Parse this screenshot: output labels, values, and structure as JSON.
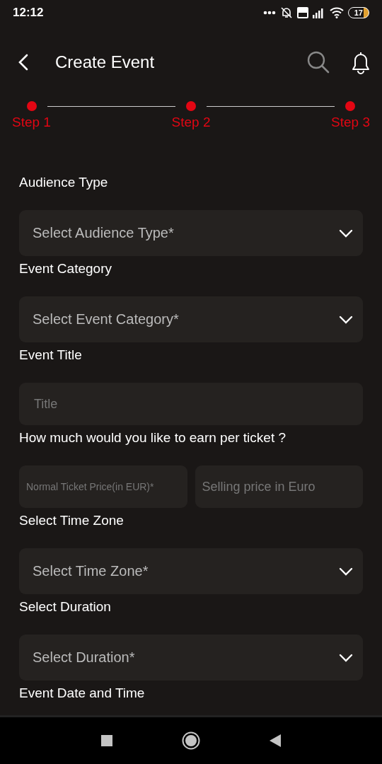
{
  "status_bar": {
    "time": "12:12",
    "battery": "17"
  },
  "header": {
    "title": "Create Event"
  },
  "steps": [
    {
      "label": "Step 1"
    },
    {
      "label": "Step 2"
    },
    {
      "label": "Step 3"
    }
  ],
  "form": [
    {
      "label": "Audience Type",
      "kind": "select",
      "placeholder": "Select Audience Type*"
    },
    {
      "label": "Event Category",
      "kind": "select",
      "placeholder": "Select Event Category*"
    },
    {
      "label": "Event Title",
      "kind": "text",
      "placeholder": "Title"
    },
    {
      "label": "How much would you like to earn per ticket ?",
      "kind": "pair",
      "placeholders": [
        "Normal Ticket Price(in EUR)*",
        "Selling price in Euro"
      ]
    },
    {
      "label": "Select Time Zone",
      "kind": "select",
      "placeholder": "Select Time Zone*"
    },
    {
      "label": "Select Duration",
      "kind": "select",
      "placeholder": "Select Duration*"
    },
    {
      "label": "Event Date and Time",
      "kind": "label"
    }
  ]
}
